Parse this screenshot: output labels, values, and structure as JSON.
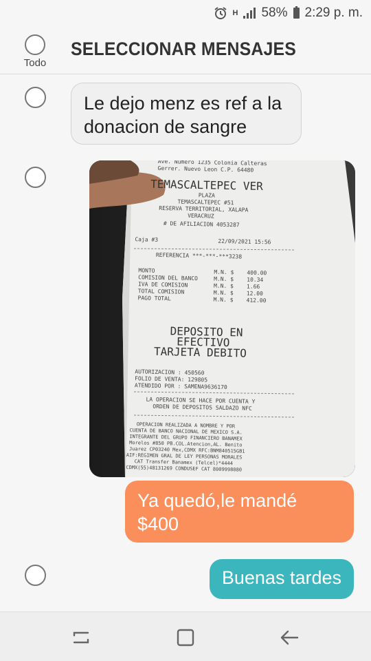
{
  "status_bar": {
    "alarm_icon": "alarm-clock-icon",
    "network_type": "H",
    "signal_icon": "signal-bars-icon",
    "battery_percent": "58%",
    "battery_icon": "battery-icon",
    "time": "2:29 p. m."
  },
  "header": {
    "select_all_label": "Todo",
    "title": "SELECCIONAR MENSAJES"
  },
  "messages": [
    {
      "direction": "incoming",
      "text": "Le dejo menz es ref a la donacion de sangre",
      "selectable": true
    },
    {
      "direction": "incoming",
      "type": "image",
      "selectable": true,
      "receipt": {
        "address_line1": "Ave. Numero 1235 Colonia Calteras",
        "address_line2": "Gerrer. Nuevo Leon C.P. 64480",
        "store": "TEMASCALTEPEC VER",
        "plaza_label": "PLAZA",
        "store_code": "TEMASCALTEPEC #51",
        "reserve": "RESERVA TERRITORIAL, XALAPA",
        "state": "VERACRUZ",
        "affiliation": "# DE AFILIACION 4053287",
        "register": "Caja #3",
        "datetime": "22/09/2021 15:56",
        "reference": "REFERENCIA ***-***-***3238",
        "lines": [
          {
            "label": "MONTO",
            "currency": "M.N. $",
            "amount": "400.00"
          },
          {
            "label": "COMISION DEL BANCO",
            "currency": "M.N. $",
            "amount": "10.34"
          },
          {
            "label": "IVA DE COMISION",
            "currency": "M.N. $",
            "amount": "1.66"
          },
          {
            "label": "TOTAL COMISION",
            "currency": "M.N. $",
            "amount": "12.00"
          },
          {
            "label": "PAGO TOTAL",
            "currency": "M.N. $",
            "amount": "412.00"
          }
        ],
        "deposit_line1": "DEPOSITO EN",
        "deposit_line2": "EFECTIVO",
        "deposit_line3": "TARJETA DEBITO",
        "authorization": "AUTORIZACION : 450560",
        "folio": "FOLIO DE VENTA: 129805",
        "attended": "ATENDIDO POR : SAMENA9636170",
        "note1": "LA OPERACION SE HACE POR CUENTA Y",
        "note2": "ORDEN DE DEPOSITOS SALDAZO NFC",
        "bank1": "OPERACION REALIZADA A NOMBRE Y POR",
        "bank2": "CUENTA DE BANCO NACIONAL DE MEXICO S.A.",
        "bank3": "INTEGRANTE DEL GRUPO FINANCIERO BANAMEX",
        "bank4": "Morelos #850 PB.COL.Atencion,AL. Benito",
        "bank5": "Juarez CP03240 Mex,CDMX RFC:BNM840515GB1",
        "bank6": "AIF:REGIMEN GRAL DE LEY PERSONAS MORALES",
        "bank7": "CAT Transfer Banamex (Telcel)*4444",
        "bank8": "CDMX(55)48131269 CONDUSEF CAT 8009998080"
      }
    },
    {
      "direction": "outgoing",
      "text": "Ya quedó,le mandé $400",
      "color": "#fa8f5c"
    },
    {
      "direction": "outgoing",
      "text": "Buenas tardes",
      "color": "#3bb6bd",
      "selectable": true
    }
  ],
  "nav_bar": {
    "recent_apps_icon": "recent-apps-icon",
    "home_icon": "home-square-icon",
    "back_icon": "back-arrow-icon"
  },
  "colors": {
    "outgoing_orange": "#fa8f5c",
    "outgoing_teal": "#3bb6bd",
    "incoming_bubble": "#f0f0f0",
    "background": "#f6f6f6"
  }
}
